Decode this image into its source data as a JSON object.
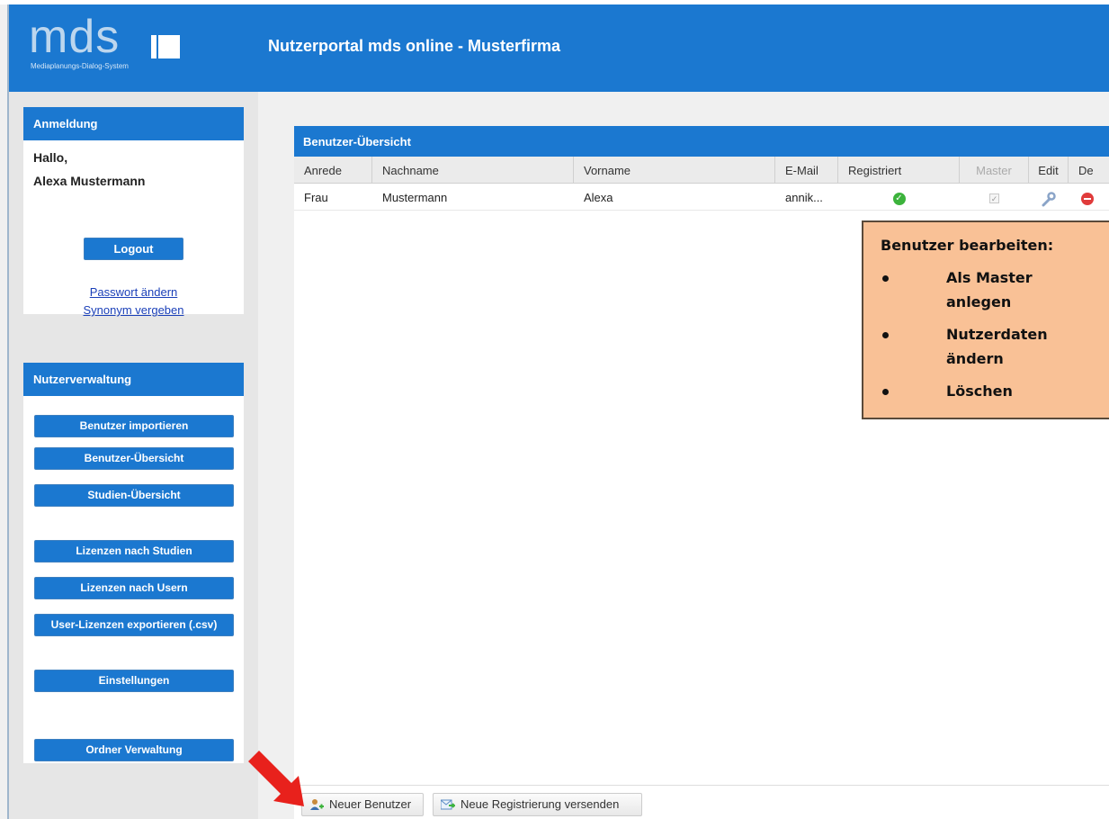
{
  "header": {
    "logo_text": "mds",
    "logo_subtitle": "Mediaplanungs-Dialog-System",
    "title": "Nutzerportal mds online - Musterfirma"
  },
  "sidebar": {
    "login_panel": {
      "title": "Anmeldung",
      "greeting": "Hallo,",
      "user_name": "Alexa Mustermann",
      "logout_label": "Logout",
      "change_password_link": "Passwort ändern",
      "synonym_link": "Synonym vergeben"
    },
    "admin_panel": {
      "title": "Nutzerverwaltung",
      "buttons": [
        "Benutzer importieren",
        "Benutzer-Übersicht",
        "Studien-Übersicht",
        "Lizenzen nach Studien",
        "Lizenzen nach Usern",
        "User-Lizenzen exportieren (.csv)",
        "Einstellungen",
        "Ordner Verwaltung"
      ]
    }
  },
  "grid": {
    "title": "Benutzer-Übersicht",
    "columns": [
      "Anrede",
      "Nachname",
      "Vorname",
      "E-Mail",
      "Registriert",
      "Master",
      "Edit",
      "De"
    ],
    "rows": [
      {
        "anrede": "Frau",
        "nachname": "Mustermann",
        "vorname": "Alexa",
        "email": "annik...",
        "registriert_icon": "check-circle-icon",
        "master_icon": "checkbox-checked-icon",
        "edit_icon": "wrench-icon",
        "delete_icon": "delete-icon"
      }
    ]
  },
  "callout": {
    "title": "Benutzer bearbeiten:",
    "items": [
      "Als Master anlegen",
      "Nutzerdaten ändern",
      "Löschen"
    ]
  },
  "toolbar": {
    "new_user_label": "Neuer Benutzer",
    "new_registration_label": "Neue Registrierung versenden"
  },
  "colors": {
    "accent": "#1b78d0",
    "callout_bg": "#f9c196",
    "arrow": "#e8211c"
  }
}
